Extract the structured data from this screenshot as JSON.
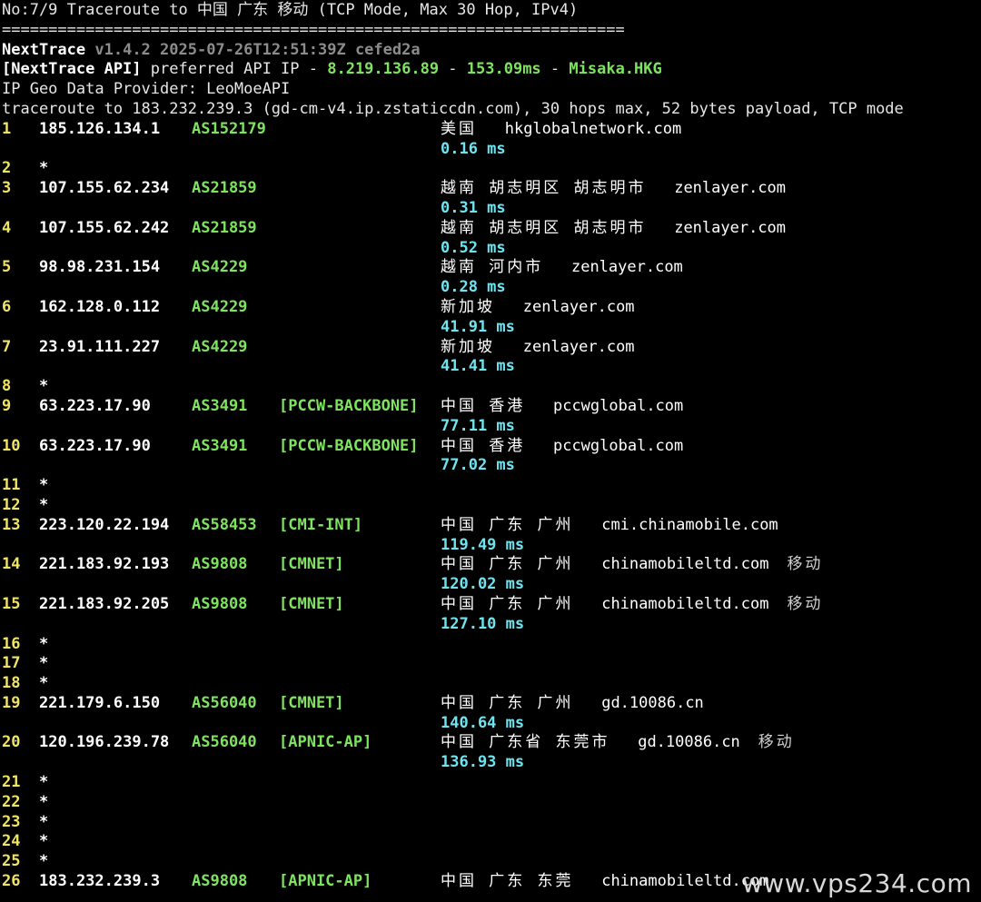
{
  "header": {
    "title_line": "No:7/9 Traceroute to 中国 广东 移动 (TCP Mode, Max 30 Hop, IPv4)",
    "separator": "===================================================================",
    "app_name": "NextTrace",
    "app_version": "v1.4.2 2025-07-26T12:51:39Z cefed2a",
    "api_label": "[NextTrace API]",
    "api_pre": " preferred API IP - ",
    "api_ip": "8.219.136.89",
    "api_dash1": " - ",
    "api_latency": "153.09ms",
    "api_dash2": " - ",
    "api_node": "Misaka.HKG",
    "geo_provider": "IP Geo Data Provider: LeoMoeAPI",
    "traceroute_line": "traceroute to 183.232.239.3 (gd-cm-v4.ip.zstaticcdn.com), 30 hops max, 52 bytes payload, TCP mode"
  },
  "hops": [
    {
      "num": "1",
      "ip": "185.126.134.1",
      "as": "AS152179",
      "tag": "",
      "geo": "美国",
      "domain": "hkglobalnetwork.com",
      "extra": "",
      "rtt": "0.16 ms"
    },
    {
      "num": "2",
      "star": "*"
    },
    {
      "num": "3",
      "ip": "107.155.62.234",
      "as": "AS21859",
      "tag": "",
      "geo": "越南 胡志明区 胡志明市",
      "domain": "zenlayer.com",
      "extra": "",
      "rtt": "0.31 ms"
    },
    {
      "num": "4",
      "ip": "107.155.62.242",
      "as": "AS21859",
      "tag": "",
      "geo": "越南 胡志明区 胡志明市",
      "domain": "zenlayer.com",
      "extra": "",
      "rtt": "0.52 ms"
    },
    {
      "num": "5",
      "ip": "98.98.231.154",
      "as": "AS4229",
      "tag": "",
      "geo": "越南 河内市",
      "domain": "zenlayer.com",
      "extra": "",
      "rtt": "0.28 ms"
    },
    {
      "num": "6",
      "ip": "162.128.0.112",
      "as": "AS4229",
      "tag": "",
      "geo": "新加坡",
      "domain": "zenlayer.com",
      "extra": "",
      "rtt": "41.91 ms"
    },
    {
      "num": "7",
      "ip": "23.91.111.227",
      "as": "AS4229",
      "tag": "",
      "geo": "新加坡",
      "domain": "zenlayer.com",
      "extra": "",
      "rtt": "41.41 ms"
    },
    {
      "num": "8",
      "star": "*"
    },
    {
      "num": "9",
      "ip": "63.223.17.90",
      "as": "AS3491",
      "tag": "[PCCW-BACKBONE]",
      "geo": "中国 香港",
      "domain": "pccwglobal.com",
      "extra": "",
      "rtt": "77.11 ms"
    },
    {
      "num": "10",
      "ip": "63.223.17.90",
      "as": "AS3491",
      "tag": "[PCCW-BACKBONE]",
      "geo": "中国 香港",
      "domain": "pccwglobal.com",
      "extra": "",
      "rtt": "77.02 ms"
    },
    {
      "num": "11",
      "star": "*"
    },
    {
      "num": "12",
      "star": "*"
    },
    {
      "num": "13",
      "ip": "223.120.22.194",
      "as": "AS58453",
      "tag": "[CMI-INT]",
      "geo": "中国 广东 广州",
      "domain": "cmi.chinamobile.com",
      "extra": "",
      "rtt": "119.49 ms"
    },
    {
      "num": "14",
      "ip": "221.183.92.193",
      "as": "AS9808",
      "tag": "[CMNET]",
      "geo": "中国 广东 广州",
      "domain": "chinamobileltd.com",
      "extra": "移动",
      "rtt": "120.02 ms"
    },
    {
      "num": "15",
      "ip": "221.183.92.205",
      "as": "AS9808",
      "tag": "[CMNET]",
      "geo": "中国 广东 广州",
      "domain": "chinamobileltd.com",
      "extra": "移动",
      "rtt": "127.10 ms"
    },
    {
      "num": "16",
      "star": "*"
    },
    {
      "num": "17",
      "star": "*"
    },
    {
      "num": "18",
      "star": "*"
    },
    {
      "num": "19",
      "ip": "221.179.6.150",
      "as": "AS56040",
      "tag": "[CMNET]",
      "geo": "中国 广东 广州",
      "domain": "gd.10086.cn",
      "extra": "",
      "rtt": "140.64 ms"
    },
    {
      "num": "20",
      "ip": "120.196.239.78",
      "as": "AS56040",
      "tag": "[APNIC-AP]",
      "geo": "中国 广东省 东莞市",
      "domain": "gd.10086.cn",
      "extra": "移动",
      "rtt": "136.93 ms"
    },
    {
      "num": "21",
      "star": "*"
    },
    {
      "num": "22",
      "star": "*"
    },
    {
      "num": "23",
      "star": "*"
    },
    {
      "num": "24",
      "star": "*"
    },
    {
      "num": "25",
      "star": "*"
    },
    {
      "num": "26",
      "ip": "183.232.239.3",
      "as": "AS9808",
      "tag": "[APNIC-AP]",
      "geo": "中国 广东 东莞",
      "domain": "chinamobileltd.com",
      "extra": "",
      "rtt": ""
    }
  ],
  "watermark": "www.vps234.com",
  "colors": {
    "background": "#000000",
    "hop_number": "#f0e464",
    "as_tag": "#7ee35f",
    "rtt": "#6ee4f0",
    "api_highlight": "#7ee35f"
  }
}
